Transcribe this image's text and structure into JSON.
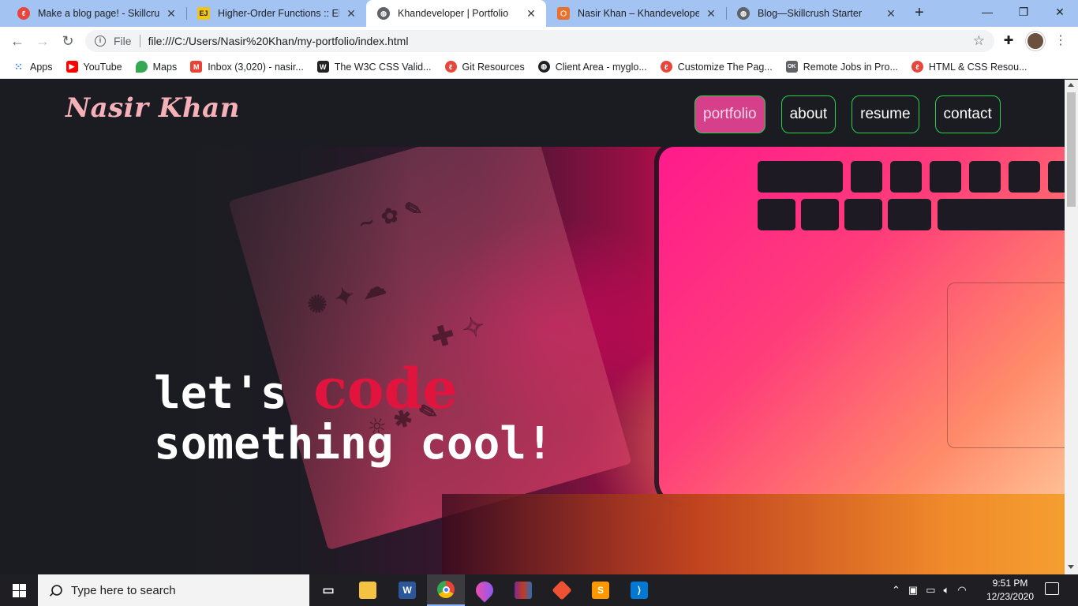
{
  "browser": {
    "tabs": [
      {
        "title": "Make a blog page! - Skillcrush",
        "favicon": "skillcrush-icon",
        "color": "#e8453c",
        "active": false
      },
      {
        "title": "Higher-Order Functions :: Eloq",
        "favicon": "ejs-icon",
        "color": "#f0c419",
        "active": false
      },
      {
        "title": "Khandeveloper | Portfolio",
        "favicon": "globe-icon",
        "color": "#5f6368",
        "active": true
      },
      {
        "title": "Nasir Khan – Khandeveloper",
        "favicon": "codepen-icon",
        "color": "#e8712c",
        "active": false
      },
      {
        "title": "Blog—Skillcrush Starter",
        "favicon": "globe-icon",
        "color": "#5f6368",
        "active": false
      }
    ],
    "address": {
      "scheme": "File",
      "url": "file:///C:/Users/Nasir%20Khan/my-portfolio/index.html"
    },
    "bookmarks": [
      {
        "label": "Apps",
        "icon": "apps-grid-icon",
        "color": "#4285f4"
      },
      {
        "label": "YouTube",
        "icon": "youtube-icon",
        "color": "#ff0000"
      },
      {
        "label": "Maps",
        "icon": "maps-pin-icon",
        "color": "#34a853"
      },
      {
        "label": "Inbox (3,020) - nasir...",
        "icon": "gmail-icon",
        "color": "#ea4335"
      },
      {
        "label": "The W3C CSS Valid...",
        "icon": "w3c-icon",
        "color": "#222222"
      },
      {
        "label": "Git Resources",
        "icon": "skillcrush-icon",
        "color": "#e8453c"
      },
      {
        "label": "Client Area - myglo...",
        "icon": "globe-icon",
        "color": "#202124"
      },
      {
        "label": "Customize The Pag...",
        "icon": "skillcrush-icon",
        "color": "#e8453c"
      },
      {
        "label": "Remote Jobs in Pro...",
        "icon": "ok-icon",
        "color": "#5f6368"
      },
      {
        "label": "HTML & CSS Resou...",
        "icon": "skillcrush-icon",
        "color": "#e8453c"
      }
    ]
  },
  "site": {
    "logo": "Nasir Khan",
    "nav": [
      {
        "label": "portfolio",
        "active": true
      },
      {
        "label": "about",
        "active": false
      },
      {
        "label": "resume",
        "active": false
      },
      {
        "label": "contact",
        "active": false
      }
    ],
    "headline": {
      "part1": "let's ",
      "highlight": "code",
      "line2": "something cool!"
    },
    "colors": {
      "logo": "#f6b0b8",
      "accent": "#d63f8a",
      "nav_border": "#28d24a",
      "highlight": "#e0143c"
    }
  },
  "taskbar": {
    "search_placeholder": "Type here to search",
    "apps": [
      "task-view-icon",
      "file-explorer-icon",
      "word-icon",
      "chrome-icon",
      "paint-drop-icon",
      "winrar-icon",
      "git-icon",
      "sublime-icon",
      "vscode-icon"
    ],
    "time": "9:51 PM",
    "date": "12/23/2020"
  }
}
